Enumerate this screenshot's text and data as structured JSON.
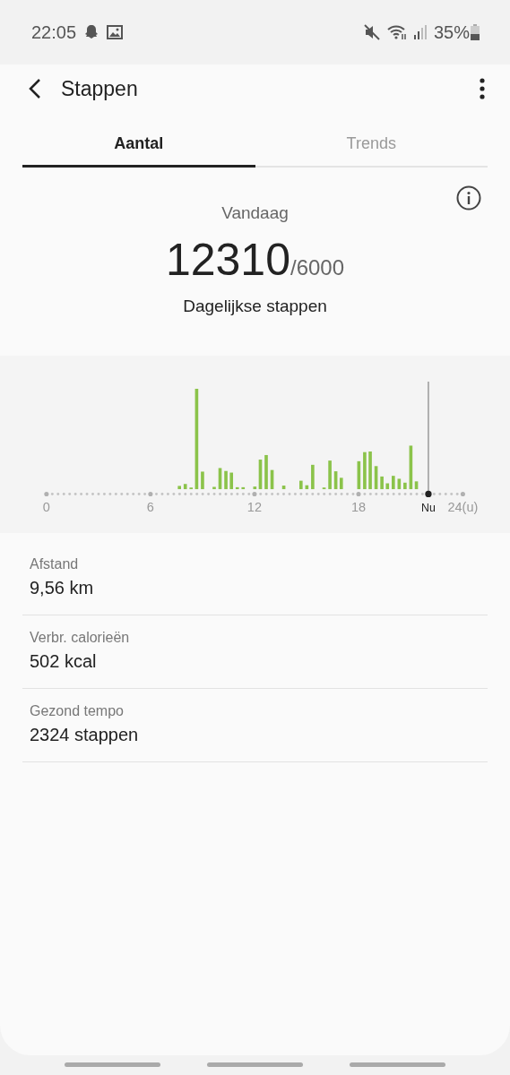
{
  "status_bar": {
    "time": "22:05",
    "battery": "35%"
  },
  "header": {
    "title": "Stappen"
  },
  "tabs": [
    {
      "label": "Aantal",
      "selected": true
    },
    {
      "label": "Trends",
      "selected": false
    }
  ],
  "summary": {
    "period": "Vandaag",
    "steps": "12310",
    "goal": "/6000",
    "caption": "Dagelijkse stappen"
  },
  "chart": {
    "x_labels": [
      "0",
      "6",
      "12",
      "18"
    ],
    "now_label": "Nu",
    "end_label": "24(u)"
  },
  "stats": [
    {
      "label": "Afstand",
      "value": "9,56 km"
    },
    {
      "label": "Verbr. calorieën",
      "value": "502 kcal"
    },
    {
      "label": "Gezond tempo",
      "value": "2324 stappen"
    }
  ]
}
